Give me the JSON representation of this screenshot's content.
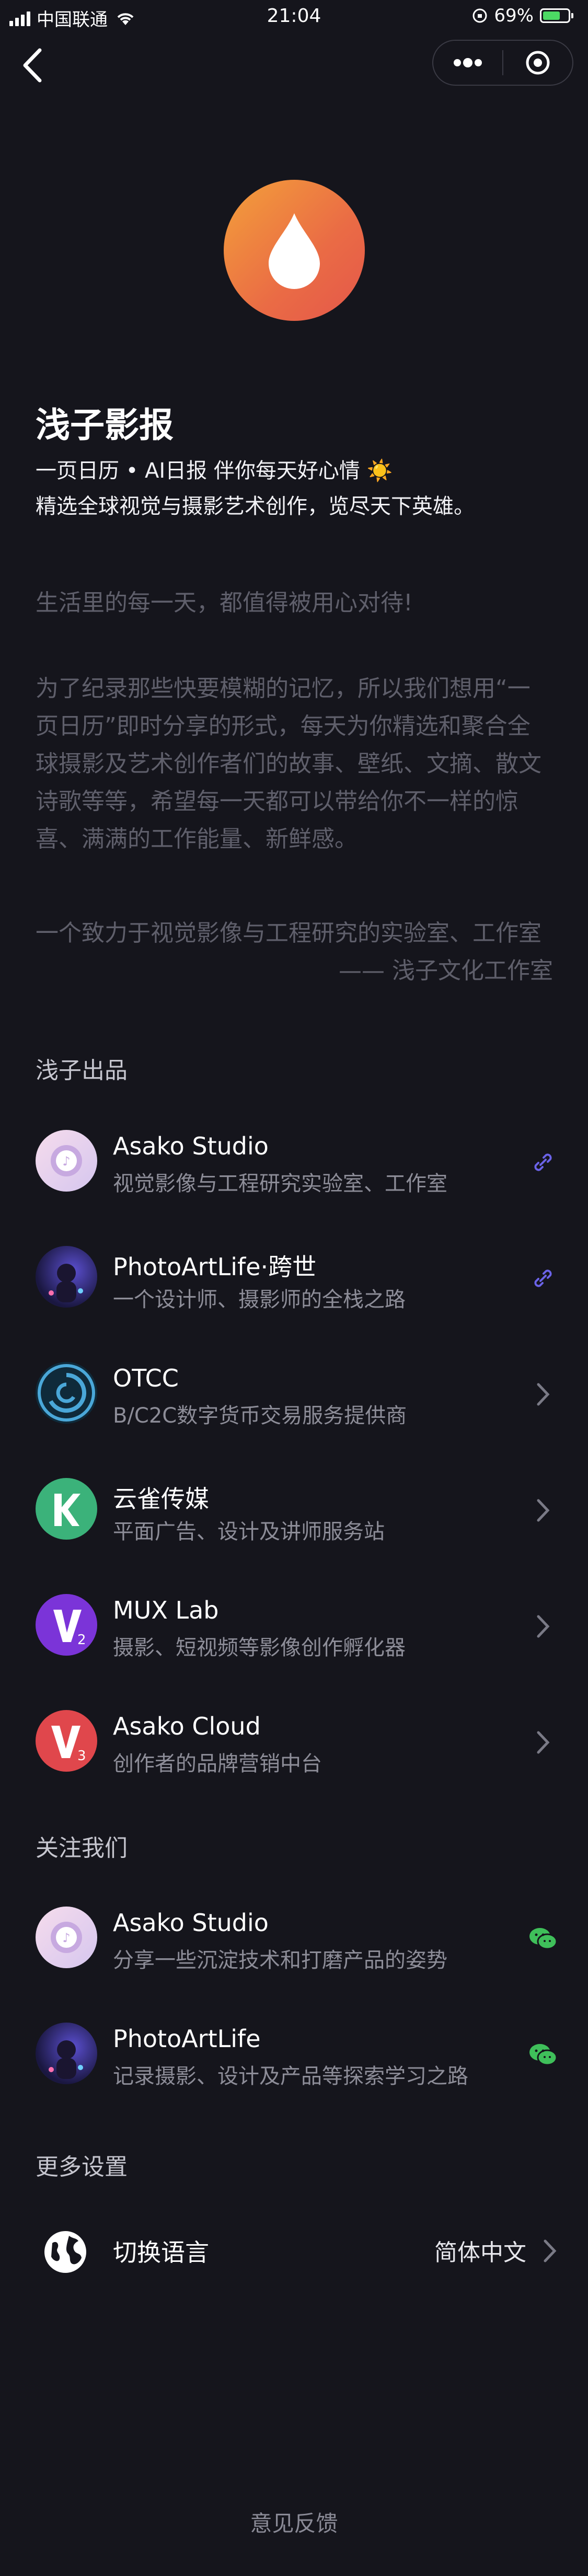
{
  "status_bar": {
    "carrier": "中国联通",
    "time": "21:04",
    "battery_percent": "69%",
    "battery_level": 0.69
  },
  "nav": {
    "back_icon": "chevron-left-icon",
    "more_icon": "more-dots-icon",
    "close_icon": "target-circle-icon"
  },
  "header": {
    "app_name": "浅子影报",
    "tagline_1": "一页日历 • AI日报 伴你每天好心情 ☀️",
    "tagline_2": "精选全球视觉与摄影艺术创作，览尽天下英雄。",
    "logo_icon": "water-drop-icon",
    "logo_colors": [
      "#f3a03a",
      "#e4574a"
    ]
  },
  "intro": {
    "p1": "生活里的每一天，都值得被用心对待!",
    "p2": "为了纪录那些快要模糊的记忆，所以我们想用“一页日历”即时分享的形式，每天为你精选和聚合全球摄影及艺术创作者们的故事、壁纸、文摘、散文诗歌等等，希望每一天都可以带给你不一样的惊喜、满满的工作能量、新鲜感。",
    "p3": "一个致力于视觉影像与工程研究的实验室、工作室",
    "signature": "—— 浅子文化工作室"
  },
  "products": {
    "title": "浅子出品",
    "items": [
      {
        "name": "Asako Studio",
        "desc": "视觉影像与工程研究实验室、工作室",
        "icon": "asako-studio-logo",
        "action": "link-icon"
      },
      {
        "name": "PhotoArtLife·跨世",
        "desc": "一个设计师、摄影师的全栈之路",
        "icon": "photoartlife-avatar",
        "action": "link-icon"
      },
      {
        "name": "OTCC",
        "desc": "B/C2C数字货币交易服务提供商",
        "icon": "otcc-logo",
        "action": "chevron-right-icon"
      },
      {
        "name": "云雀传媒",
        "desc": "平面广告、设计及讲师服务站",
        "icon": "yunque-logo",
        "action": "chevron-right-icon"
      },
      {
        "name": "MUX Lab",
        "desc": "摄影、短视频等影像创作孵化器",
        "icon": "mux-lab-logo",
        "action": "chevron-right-icon"
      },
      {
        "name": "Asako Cloud",
        "desc": "创作者的品牌营销中台",
        "icon": "asako-cloud-logo",
        "action": "chevron-right-icon"
      }
    ]
  },
  "follow": {
    "title": "关注我们",
    "items": [
      {
        "name": "Asako Studio",
        "desc": "分享一些沉淀技术和打磨产品的姿势",
        "icon": "asako-studio-logo",
        "action": "wechat-icon"
      },
      {
        "name": "PhotoArtLife",
        "desc": "记录摄影、设计及产品等探索学习之路",
        "icon": "photoartlife-avatar",
        "action": "wechat-icon"
      }
    ]
  },
  "settings": {
    "title": "更多设置",
    "language_label": "切换语言",
    "language_value": "简体中文",
    "language_icon": "globe-icon"
  },
  "footer": {
    "feedback": "意见反馈"
  },
  "colors": {
    "background": "#15151c",
    "link_accent": "#6b63e8",
    "wechat_green": "#3fbf5a",
    "muted_text": "#5f5f6b"
  }
}
